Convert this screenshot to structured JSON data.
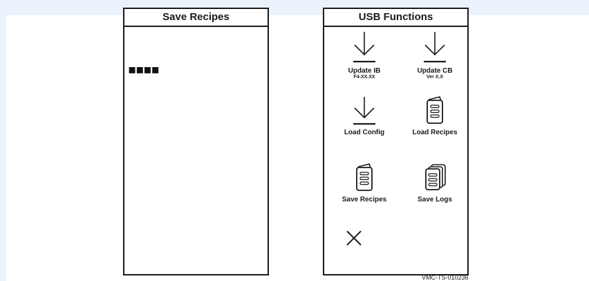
{
  "left_panel": {
    "title": "Save Recipes",
    "progress_text": "▪▪▪▪"
  },
  "right_panel": {
    "title": "USB Functions",
    "functions": [
      {
        "label": "Update IB",
        "sub": "F4-XX.XX",
        "icon": "download-icon"
      },
      {
        "label": "Update CB",
        "sub": "Ver X.X",
        "icon": "download-icon"
      },
      {
        "label": "Load Config",
        "sub": "",
        "icon": "download-icon"
      },
      {
        "label": "Load Recipes",
        "sub": "",
        "icon": "document-icon"
      },
      {
        "label": "Save Recipes",
        "sub": "",
        "icon": "document-icon"
      },
      {
        "label": "Save Logs",
        "sub": "",
        "icon": "documents-stack-icon"
      }
    ],
    "close_icon": "close-icon"
  },
  "document_code": "VMC-TS-010236"
}
